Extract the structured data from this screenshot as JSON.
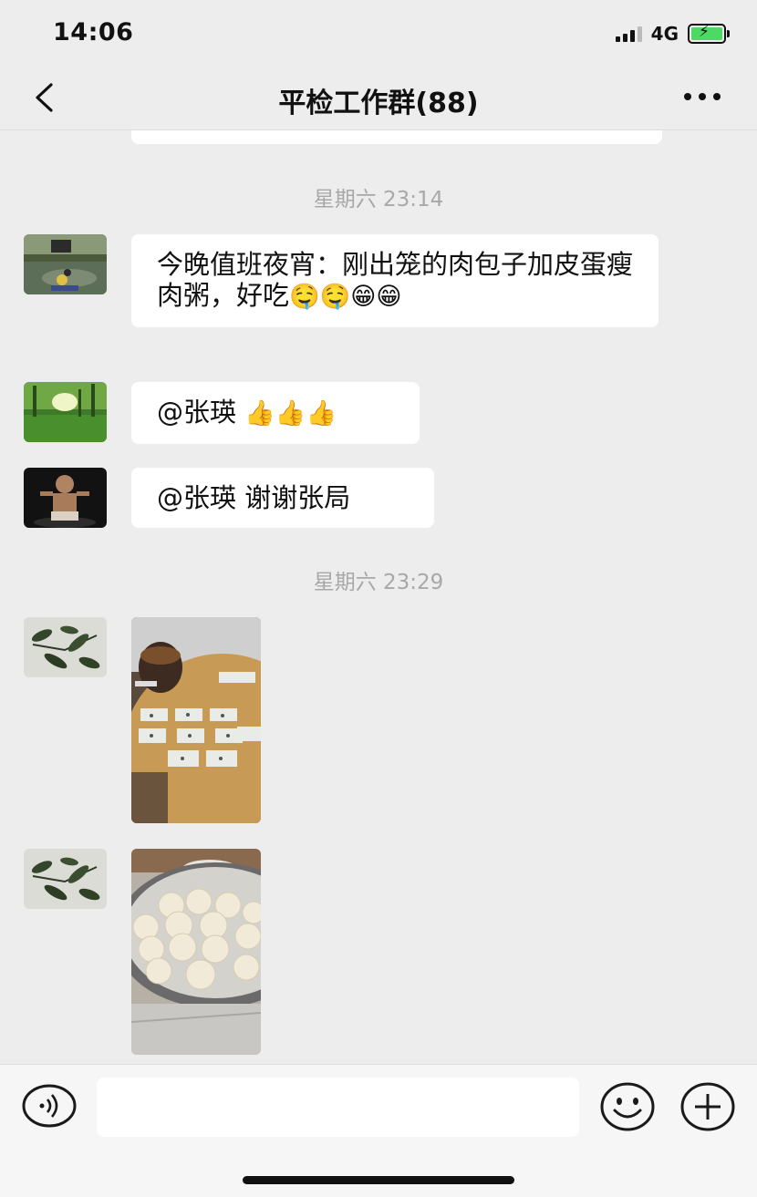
{
  "status": {
    "time": "14:06",
    "network": "4G"
  },
  "header": {
    "title": "平检工作群(88)"
  },
  "messages": [
    {
      "type": "timestamp",
      "text": "星期六 23:14"
    },
    {
      "type": "text",
      "avatar": "avatar-scene-pond",
      "text": "今晚值班夜宵：刚出笼的肉包子加皮蛋瘦肉粥，好吃",
      "emojis": "🤤🤤😁😁"
    },
    {
      "type": "text",
      "avatar": "avatar-forest",
      "text": "@张瑛 ",
      "emojis": "👍👍👍"
    },
    {
      "type": "text",
      "avatar": "avatar-dark-figure",
      "text": "@张瑛 谢谢张局"
    },
    {
      "type": "timestamp",
      "text": "星期六 23:29"
    },
    {
      "type": "image",
      "avatar": "avatar-plant",
      "description_icon": "photo-porridge"
    },
    {
      "type": "image",
      "avatar": "avatar-plant",
      "description_icon": "photo-buns-steamer"
    }
  ],
  "input": {
    "placeholder": ""
  },
  "colors": {
    "background": "#ededed",
    "bubble": "#ffffff",
    "timestamp": "#a8a8a8"
  }
}
